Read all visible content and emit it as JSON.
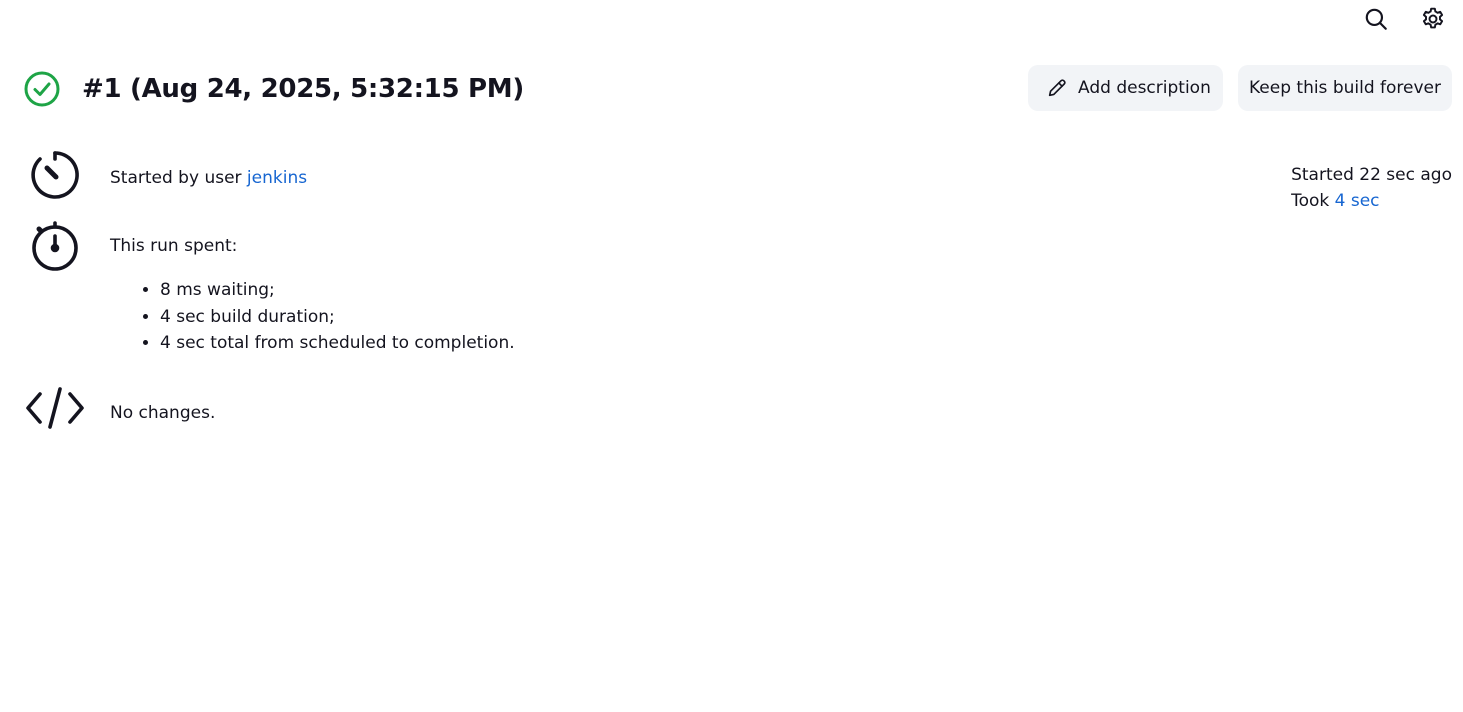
{
  "topbar": {
    "icons": [
      "search-icon",
      "gear-icon",
      "user-icon"
    ]
  },
  "header": {
    "status_icon": "check-circle-icon",
    "status_color": "#1ea446",
    "title": "#1 (Aug 24, 2025, 5:32:15 PM)",
    "add_description_label": "Add description",
    "keep_forever_label": "Keep this build forever"
  },
  "started": {
    "icon": "timer-icon",
    "prefix": "Started by user ",
    "user": "jenkins",
    "started_ago": "Started 22 sec ago",
    "took_prefix": "Took ",
    "took_value": "4 sec"
  },
  "spent": {
    "icon": "stopwatch-icon",
    "heading": "This run spent:",
    "items": [
      "8 ms waiting;",
      "4 sec build duration;",
      "4 sec total from scheduled to completion."
    ]
  },
  "changes": {
    "icon": "code-icon",
    "text": "No changes."
  },
  "colors": {
    "link": "#1766d1",
    "button_bg": "#f2f4f7",
    "text": "#14141f"
  }
}
